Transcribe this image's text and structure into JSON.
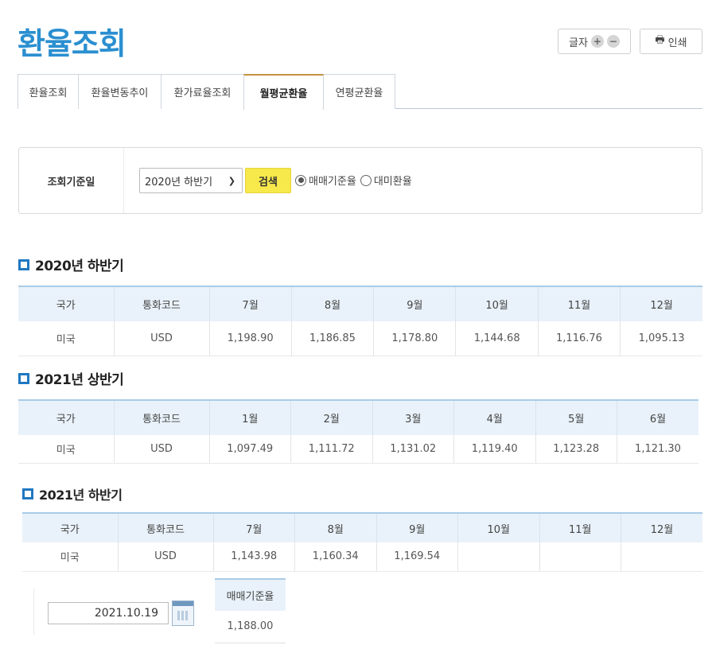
{
  "page": {
    "title": "환율조회"
  },
  "toolbar": {
    "font_size_label": "글자",
    "plus": "+",
    "minus": "−",
    "print_label": "인쇄"
  },
  "tabs": [
    {
      "label": "환율조회"
    },
    {
      "label": "환율변동추이"
    },
    {
      "label": "환가료율조회"
    },
    {
      "label": "월평균환율",
      "active": true
    },
    {
      "label": "연평균환율"
    }
  ],
  "search": {
    "label": "조회기준일",
    "period_selected": "2020년 하반기",
    "search_button": "검색",
    "radio_options": [
      {
        "label": "매매기준율",
        "checked": true
      },
      {
        "label": "대미환율",
        "checked": false
      }
    ]
  },
  "sections": [
    {
      "title": "2020년 하반기",
      "headers": [
        "국가",
        "통화코드",
        "7월",
        "8월",
        "9월",
        "10월",
        "11월",
        "12월"
      ],
      "rows": [
        [
          "미국",
          "USD",
          "1,198.90",
          "1,186.85",
          "1,178.80",
          "1,144.68",
          "1,116.76",
          "1,095.13"
        ]
      ]
    },
    {
      "title": "2021년 상반기",
      "headers": [
        "국가",
        "통화코드",
        "1월",
        "2월",
        "3월",
        "4월",
        "5월",
        "6월"
      ],
      "rows": [
        [
          "미국",
          "USD",
          "1,097.49",
          "1,111.72",
          "1,131.02",
          "1,119.40",
          "1,123.28",
          "1,121.30"
        ]
      ]
    },
    {
      "title": "2021년 하반기",
      "headers": [
        "국가",
        "통화코드",
        "7월",
        "8월",
        "9월",
        "10월",
        "11월",
        "12월"
      ],
      "rows": [
        [
          "미국",
          "USD",
          "1,143.98",
          "1,160.34",
          "1,169.54",
          "",
          "",
          ""
        ]
      ]
    }
  ],
  "date_lookup": {
    "date_value": "2021.10.19",
    "rate_header": "매매기준율",
    "rate_value": "1,188.00"
  },
  "colors": {
    "title": "#2a8fd0",
    "accent_icon": "#1f78c1",
    "search_button": "#f7e94b",
    "header_bg": "#e9f2fa"
  }
}
